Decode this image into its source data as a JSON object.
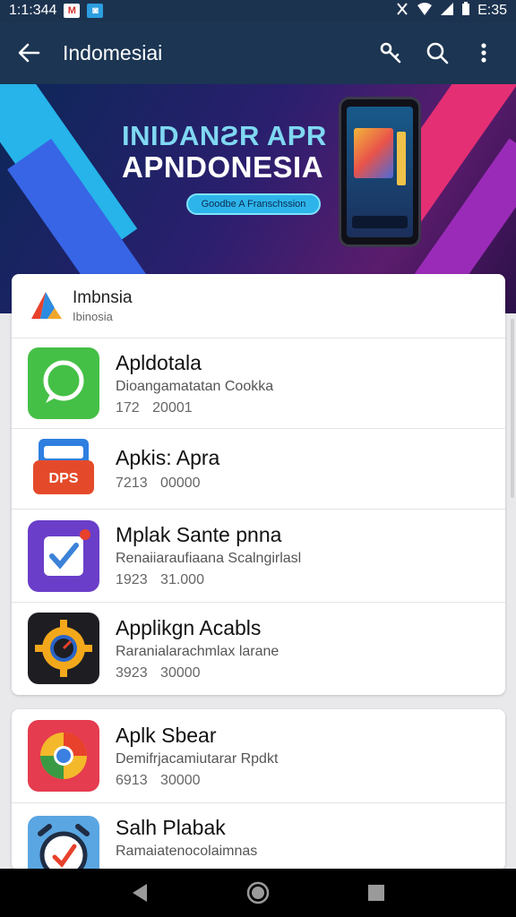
{
  "status": {
    "time": "1:1:344",
    "right_time": "E:35"
  },
  "app_bar": {
    "title": "Indomesiai"
  },
  "banner": {
    "headline1": "INIDANƧR APR",
    "headline2": "APNDONESIA",
    "pill_text": "Goodbe A Franschssion",
    "active_dot": 1
  },
  "section": {
    "title": "Imbnsia",
    "subtitle": "Ibinosia"
  },
  "apps_card1": [
    {
      "name": "Apldotala",
      "desc": "Dioangamatatan Cookka",
      "meta": "172 20001",
      "icon": "chat-bubble-icon"
    },
    {
      "name": "Apkis: Apra",
      "desc": "",
      "meta": "7213 00000",
      "icon": "dps-icon"
    },
    {
      "name": "Mplak Sante pnna",
      "desc": "Renaiiaraufiaana Scalngirlasl",
      "meta": "1923 31.000",
      "icon": "checklist-icon"
    },
    {
      "name": "Applikgn Acabls",
      "desc": "Raranialarachmlax larane",
      "meta": "3923 30000",
      "icon": "gear-speedometer-icon"
    }
  ],
  "apps_card2": [
    {
      "name": "Aplk Sbear",
      "desc": "Demifrjacamiutarar Rpdkt",
      "meta": "6913 30000",
      "icon": "chrome-icon"
    },
    {
      "name": "Salh Plabak",
      "desc": "Ramaiatenocolaimnas",
      "meta": "",
      "icon": "alarm-clock-icon"
    }
  ]
}
